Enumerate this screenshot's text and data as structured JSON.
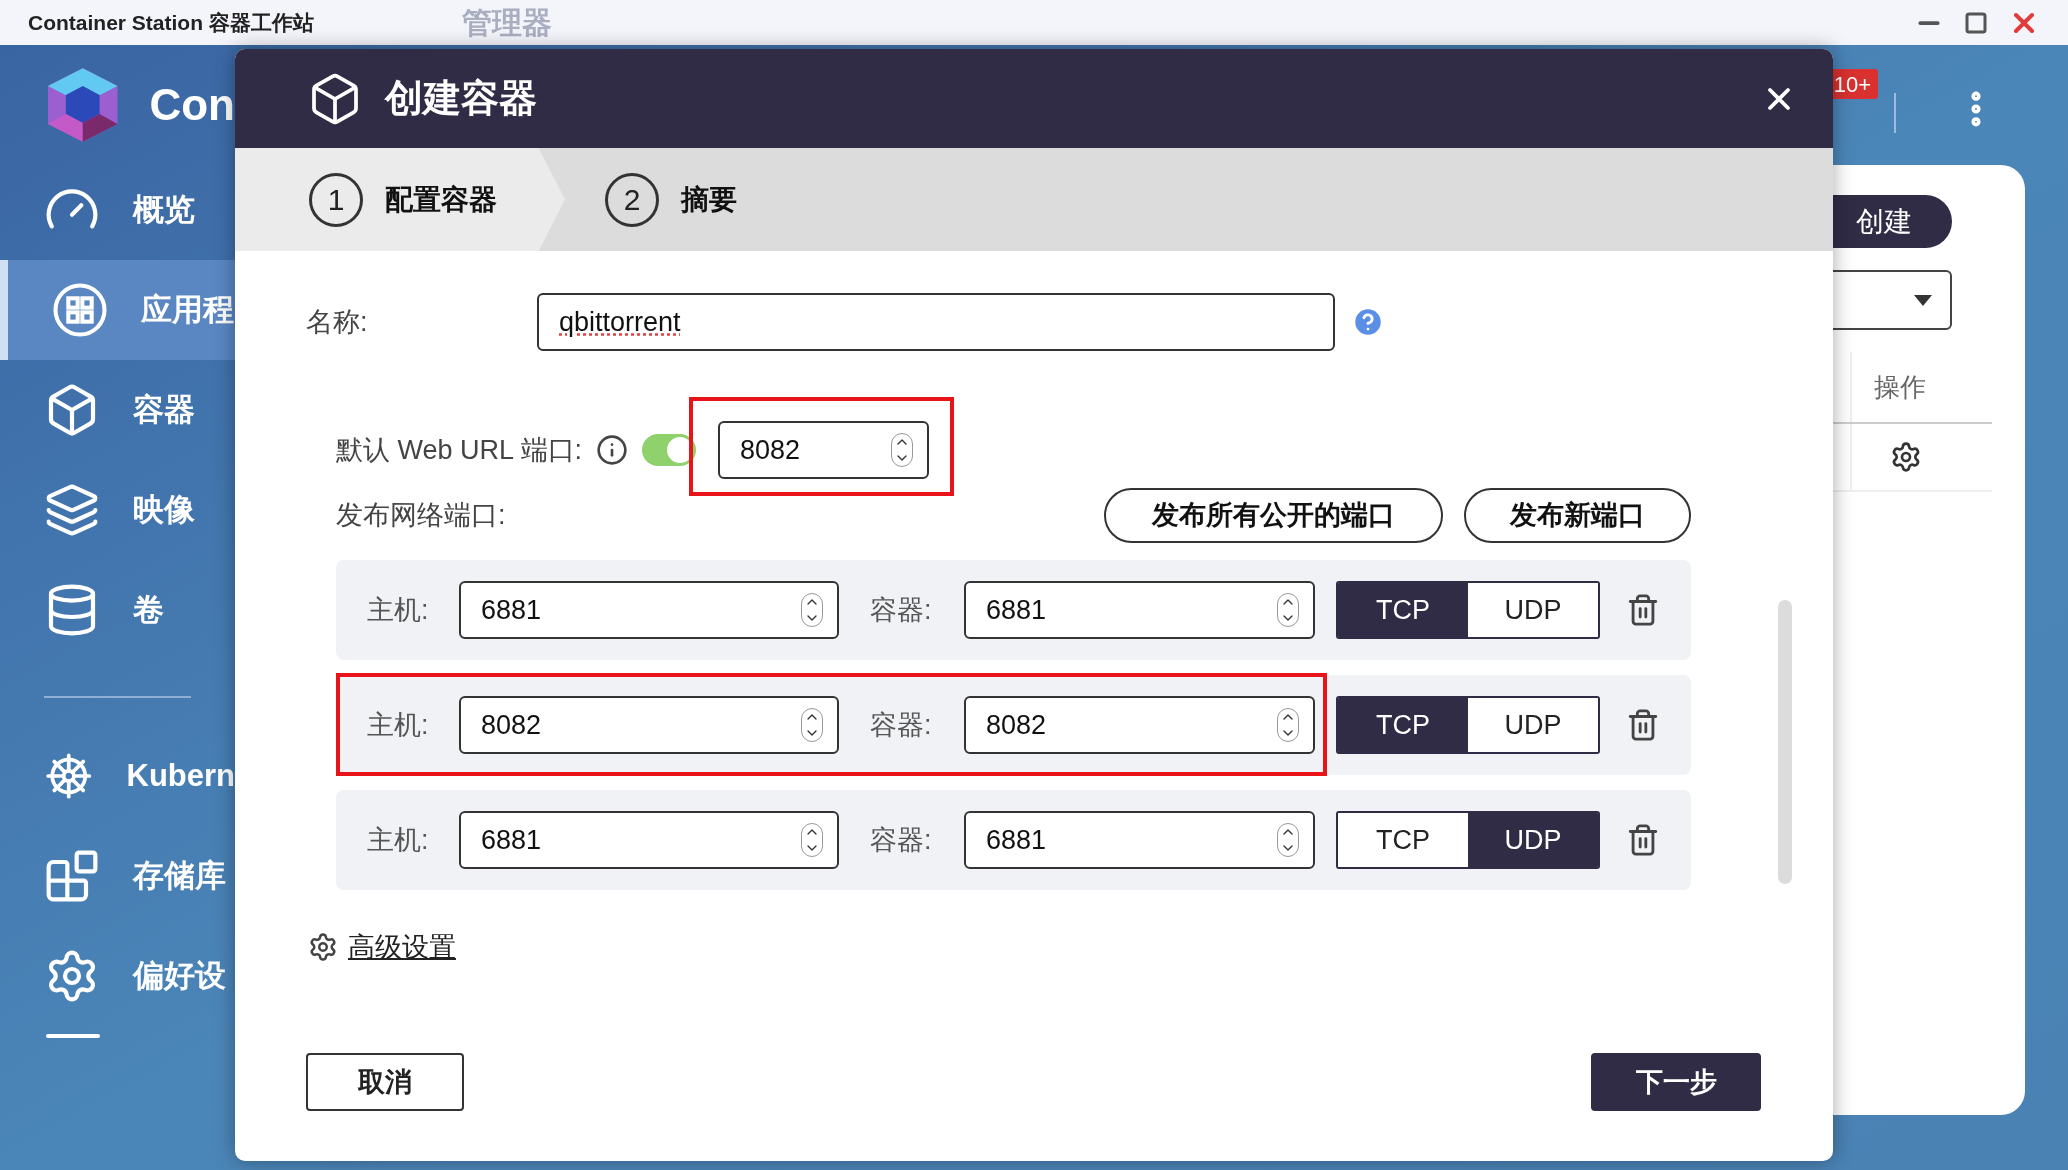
{
  "window": {
    "title": "Container Station 容器工作站",
    "faded_title": "管理器"
  },
  "app": {
    "name": "Con",
    "notification_badge": "10+"
  },
  "sidebar": {
    "groups": [
      [
        {
          "kind": "gauge",
          "label": "概览",
          "selected": false
        },
        {
          "kind": "apps",
          "label": "应用程",
          "selected": true
        },
        {
          "kind": "cube",
          "label": "容器",
          "selected": false
        },
        {
          "kind": "layers",
          "label": "映像",
          "selected": false
        },
        {
          "kind": "database",
          "label": "卷",
          "selected": false
        }
      ],
      [
        {
          "kind": "wheel",
          "label": "Kubern",
          "selected": false
        },
        {
          "kind": "blocks",
          "label": "存储库",
          "selected": false
        },
        {
          "kind": "gear",
          "label": "偏好设",
          "selected": false
        }
      ]
    ]
  },
  "background_panel": {
    "create_button": "创建",
    "column_header": "操作"
  },
  "dialog": {
    "title": "创建容器",
    "steps": [
      {
        "number": "1",
        "label": "配置容器",
        "selected": true
      },
      {
        "number": "2",
        "label": "摘要",
        "selected": false
      }
    ],
    "name": {
      "label": "名称:",
      "value": "qbittorrent"
    },
    "web_url_port": {
      "label": "默认 Web URL 端口:",
      "on": true,
      "value": "8082",
      "highlighted": true
    },
    "publish_label": "发布网络端口:",
    "publish_buttons": [
      "发布所有公开的端口",
      "发布新端口"
    ],
    "ports": [
      {
        "host_label": "主机:",
        "host": "6881",
        "container_label": "容器:",
        "container": "6881",
        "highlighted": false,
        "protocols": [
          {
            "label": "TCP",
            "selected": true
          },
          {
            "label": "UDP",
            "selected": false
          }
        ]
      },
      {
        "host_label": "主机:",
        "host": "8082",
        "container_label": "容器:",
        "container": "8082",
        "highlighted": true,
        "protocols": [
          {
            "label": "TCP",
            "selected": true
          },
          {
            "label": "UDP",
            "selected": false
          }
        ]
      },
      {
        "host_label": "主机:",
        "host": "6881",
        "container_label": "容器:",
        "container": "6881",
        "highlighted": false,
        "protocols": [
          {
            "label": "TCP",
            "selected": false
          },
          {
            "label": "UDP",
            "selected": true
          }
        ]
      }
    ],
    "advanced": "高级设置",
    "cancel": "取消",
    "next": "下一步"
  }
}
